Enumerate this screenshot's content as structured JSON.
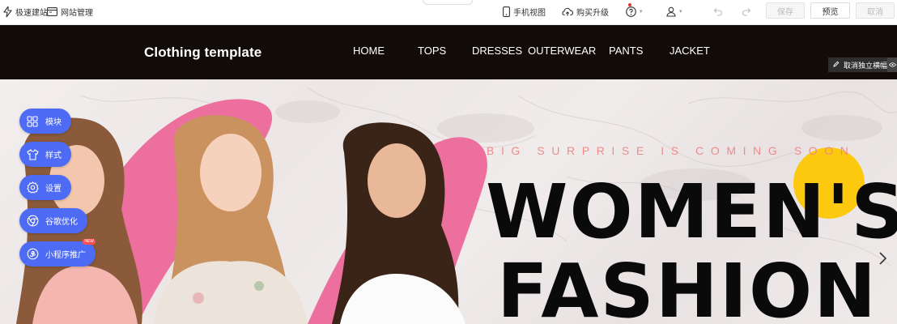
{
  "toolbar": {
    "quick_build": "极速建站",
    "site_manage": "网站管理",
    "mobile_view": "手机视图",
    "upgrade": "购买升级",
    "save": "保存",
    "preview": "预览",
    "cancel": "取消"
  },
  "site": {
    "brand": "Clothing template",
    "nav": [
      "HOME",
      "TOPS",
      "DRESSES",
      "OUTERWEAR",
      "PANTS",
      "JACKET"
    ],
    "cancel_fullwidth": "取消独立横幅"
  },
  "hero": {
    "tagline": "BIG SURPRISE IS COMING SOON",
    "headline_line1": "WOMEN'S",
    "headline_line2": "FASHION",
    "colors": {
      "pink": "#ec6f9d",
      "yellow": "#fcc90f",
      "headline": "#0a0a0a",
      "tagline": "#f08a8a"
    }
  },
  "side_tools": [
    {
      "label": "模块",
      "icon": "grid-icon"
    },
    {
      "label": "样式",
      "icon": "shirt-icon"
    },
    {
      "label": "设置",
      "icon": "gear-icon"
    },
    {
      "label": "谷歌优化",
      "icon": "chrome-icon"
    },
    {
      "label": "小程序推广",
      "icon": "miniprogram-icon",
      "badge": "NEW"
    }
  ],
  "accent": "#4e6bf5"
}
